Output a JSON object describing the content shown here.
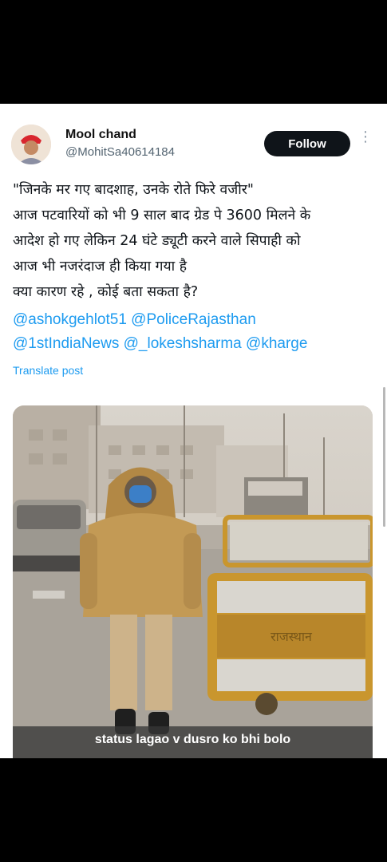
{
  "post": {
    "author_name": "Mool chand",
    "handle": "@MohitSa40614184",
    "follow_label": "Follow",
    "more_icon": "⋮",
    "text_lines": [
      "\"जिनके मर गए बादशाह, उनके रोते फिरे वजीर\"",
      "आज पटवारियों को भी 9 साल बाद ग्रेड पे 3600 मिलने के",
      "आदेश हो गए लेकिन 24 घंटे ड्यूटी करने वाले सिपाही को",
      "आज भी नजरंदाज ही किया गया है",
      "क्या कारण रहे , कोई बता सकता है?"
    ],
    "mention_lines": [
      "@ashokgehlot51 @PoliceRajasthan",
      "@1stIndiaNews @_lokeshsharma @kharge"
    ],
    "translate_label": "Translate post"
  },
  "image": {
    "barricade_text": "राजस्थान",
    "caption": "status lagao v dusro ko bhi bolo"
  },
  "colors": {
    "link": "#1d9bf0",
    "follow_bg": "#0f1419",
    "coat": "#c39a55",
    "barricade": "#c9962e"
  }
}
